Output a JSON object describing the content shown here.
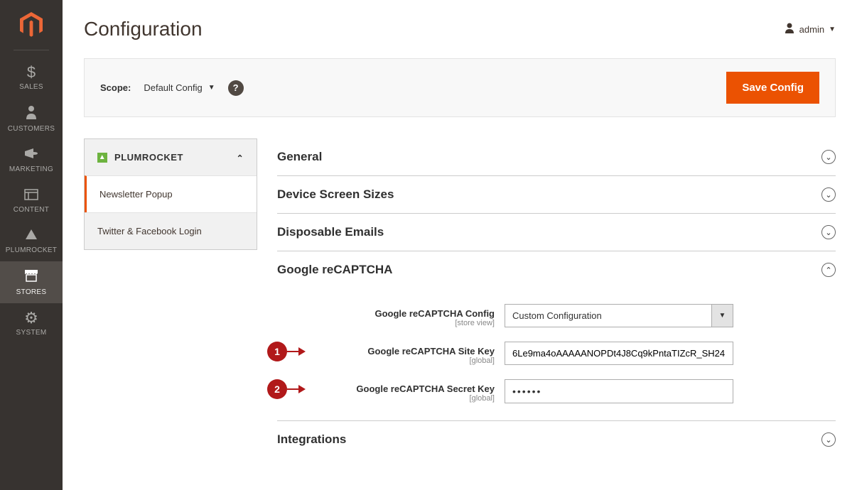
{
  "page": {
    "title": "Configuration"
  },
  "user": {
    "name": "admin"
  },
  "toolbar": {
    "scope_label": "Scope:",
    "scope_value": "Default Config",
    "save_label": "Save Config"
  },
  "sidebar_nav": [
    {
      "id": "sales",
      "label": "SALES",
      "icon": "$"
    },
    {
      "id": "customers",
      "label": "CUSTOMERS",
      "icon": "person"
    },
    {
      "id": "marketing",
      "label": "MARKETING",
      "icon": "megaphone"
    },
    {
      "id": "content",
      "label": "CONTENT",
      "icon": "layout"
    },
    {
      "id": "plumrocket",
      "label": "PLUMROCKET",
      "icon": "mountain"
    },
    {
      "id": "stores",
      "label": "STORES",
      "icon": "store",
      "active": true
    },
    {
      "id": "system",
      "label": "SYSTEM",
      "icon": "gear"
    }
  ],
  "config_tabs": {
    "group": "PLUMROCKET",
    "items": [
      {
        "label": "Newsletter Popup",
        "active": true
      },
      {
        "label": "Twitter & Facebook Login"
      }
    ]
  },
  "sections": {
    "general": "General",
    "device": "Device Screen Sizes",
    "disposable": "Disposable Emails",
    "recaptcha": "Google reCAPTCHA",
    "integrations": "Integrations"
  },
  "recaptcha": {
    "config_label": "Google reCAPTCHA Config",
    "config_scope": "[store view]",
    "config_value": "Custom Configuration",
    "site_key_label": "Google reCAPTCHA Site Key",
    "site_key_scope": "[global]",
    "site_key_value": "6Le9ma4oAAAAANOPDt4J8Cq9kPntaTIZcR_SH24",
    "secret_key_label": "Google reCAPTCHA Secret Key",
    "secret_key_scope": "[global]",
    "secret_key_value": "••••••"
  },
  "callouts": {
    "one": "1",
    "two": "2"
  }
}
